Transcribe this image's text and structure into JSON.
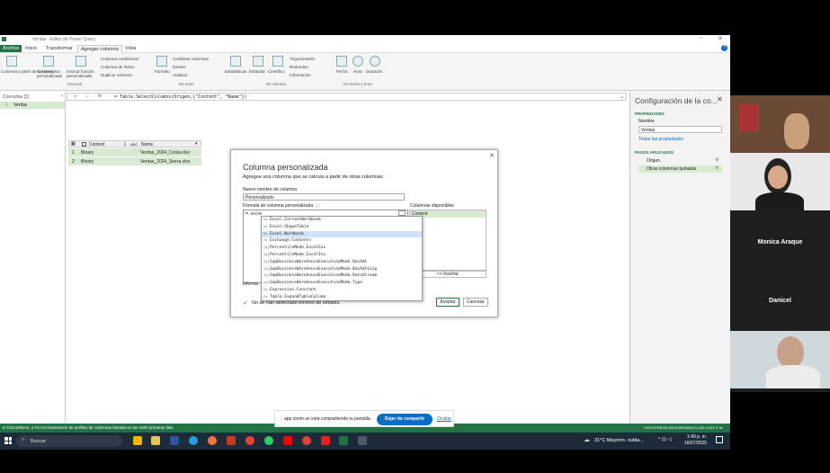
{
  "window": {
    "title": "Ventas - Editor de Power Query"
  },
  "tabs": [
    "Archivo",
    "Inicio",
    "Transformar",
    "Agregar columna",
    "Vista"
  ],
  "ribbon": {
    "items": [
      "Columna a partir de los ejemplos",
      "Columna personalizada",
      "Invocar función personalizada",
      "Columna condicional",
      "Columna de índice",
      "Duplicar columna",
      "Formato",
      "Combinar columnas",
      "Extraer",
      "Analizar",
      "Estadísticas",
      "Estándar",
      "Científico",
      "Trigonometría",
      "Redondeo",
      "Información",
      "Fecha",
      "Hora",
      "Duración"
    ],
    "groups": [
      "General",
      "De texto",
      "De número",
      "De fecha y hora"
    ]
  },
  "queries": {
    "header": "Consultas [1]",
    "item": "Ventas"
  },
  "formula_bar": {
    "formula": "= Table.SelectColumns(Origen,{\"Content\", \"Name\"})"
  },
  "table": {
    "headers": [
      "Content",
      "Name"
    ],
    "rows": [
      [
        "1",
        "Binary",
        "Ventas_2024_Costa.xlsx"
      ],
      [
        "2",
        "Binary",
        "Ventas_2024_Sierra.xlsx"
      ]
    ]
  },
  "settings": {
    "title": "Configuración de la co...",
    "properties_label": "PROPIEDADES",
    "name_label": "Nombre",
    "name_value": "Ventas",
    "all_props": "Todas las propiedades",
    "steps_label": "PASOS APLICADOS",
    "steps": [
      "Origen",
      "Otras columnas quitadas"
    ]
  },
  "dialog": {
    "title": "Columna personalizada",
    "subtitle": "Agregue una columna que se calcula a partir de otras columnas.",
    "name_label": "Nuevo nombre de columna",
    "name_value": "Personalizado",
    "formula_label": "Fórmula de columna personalizada",
    "formula_value": "= exce",
    "available_label": "Columnas disponibles",
    "available": [
      "Content"
    ],
    "insert_button": "<< Insertar",
    "info_label": "Informa",
    "status": "No se han detectado errores de sintaxis.",
    "ok": "Aceptar",
    "cancel": "Cancelar",
    "autocomplete": [
      "Excel.CurrentWorkbook",
      "Excel.ShapeTable",
      "Excel.Workbook",
      "Exchange.Contents",
      "PercentileMode.ExcelExc",
      "PercentileMode.ExcelInc",
      "SapBusinessWarehouseExecutionMode.BasXml",
      "SapBusinessWarehouseExecutionMode.BasXmlGzip",
      "SapBusinessWarehouseExecutionMode.DataStream",
      "SapBusinessWarehouseExecutionMode.Type",
      "Expression.Constant",
      "Table.ExpandTableColumn"
    ]
  },
  "statusbar": {
    "left": "6 COLUMNAS, 2 FILAS",
    "middle": "Generación de perfiles de columnas basada en las 1000 primeras filas",
    "right": "VISTA PREVIA DESCARGADA A LAS 14:01 P. M."
  },
  "share_bar": {
    "text": "app.zoom.us está compartiendo tu pantalla.",
    "stop": "Dejar de compartir",
    "hide": "Ocultar"
  },
  "taskbar": {
    "search": "Buscar",
    "weather": "31°C  Mayorm. nubla...",
    "time": "1:40 p. m.",
    "date": "16/07/2025"
  },
  "participants": [
    "Monica Araque",
    "Danicel"
  ],
  "colors": {
    "excel_green": "#217346",
    "accent": "#0b6cc5"
  }
}
